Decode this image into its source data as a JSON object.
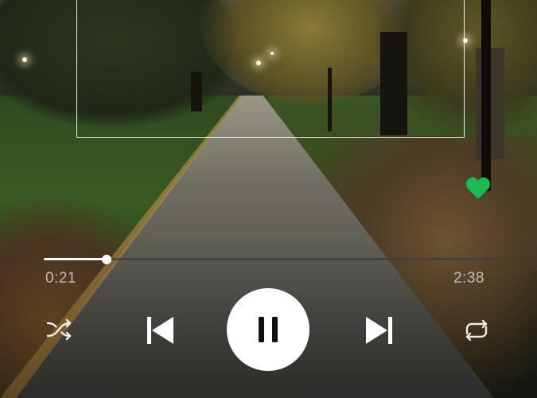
{
  "player": {
    "elapsed": "0:21",
    "total": "2:38",
    "progress": 0.14,
    "liked": true
  },
  "colors": {
    "accent": "#1DB954",
    "controls": "#ffffff"
  },
  "controls": {
    "shuffle_icon": "shuffle-icon",
    "previous_icon": "skip-previous-icon",
    "play_pause_icon": "pause-icon",
    "next_icon": "skip-next-icon",
    "repeat_icon": "repeat-icon",
    "like_icon": "heart-icon"
  }
}
